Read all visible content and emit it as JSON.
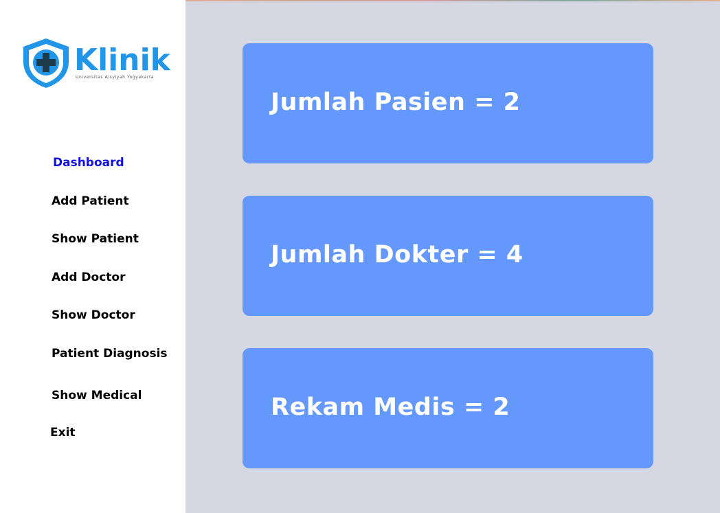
{
  "logo": {
    "wordmark": "Klinik",
    "tagline": "Universitas Aisyiyah Yogyakarta"
  },
  "sidebar": {
    "items": [
      {
        "label": "Dashboard",
        "active": true
      },
      {
        "label": "Add Patient"
      },
      {
        "label": "Show Patient"
      },
      {
        "label": "Add Doctor"
      },
      {
        "label": "Show Doctor"
      },
      {
        "label": "Patient Diagnosis"
      },
      {
        "label": "Show Medical"
      },
      {
        "label": "Exit"
      }
    ]
  },
  "stats": [
    {
      "label": "Jumlah Pasien",
      "value": 2,
      "text": "Jumlah Pasien = 2"
    },
    {
      "label": "Jumlah Dokter",
      "value": 4,
      "text": "Jumlah Dokter = 4"
    },
    {
      "label": "Rekam Medis",
      "value": 2,
      "text": "Rekam Medis = 2"
    }
  ],
  "colors": {
    "card": "#6598fd",
    "main_bg": "#d5d8e2",
    "active_nav": "#1010e0",
    "brand": "#2196e8"
  }
}
